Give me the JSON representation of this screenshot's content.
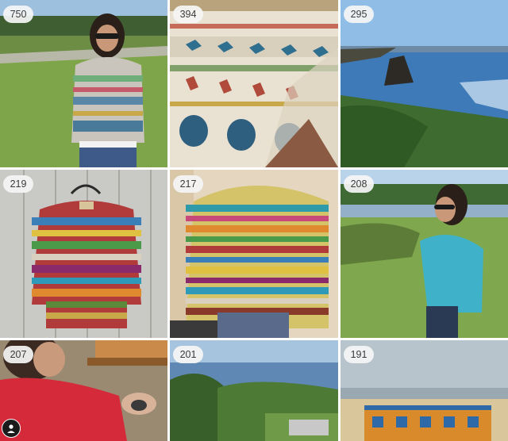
{
  "grid": {
    "tiles": [
      {
        "count": "750",
        "subject": "woman in colorwork sweater on coastal lawn"
      },
      {
        "count": "394",
        "subject": "close-up of bird and peacock colorwork knitting"
      },
      {
        "count": "295",
        "subject": "rocky coastline and ocean"
      },
      {
        "count": "219",
        "subject": "rainbow striped sweater on hanger"
      },
      {
        "count": "217",
        "subject": "striped sweater in progress on table"
      },
      {
        "count": "208",
        "subject": "woman in turquoise sweater"
      },
      {
        "count": "207",
        "subject": "woman in red cardigan knitting"
      },
      {
        "count": "201",
        "subject": "coastal view with trees"
      },
      {
        "count": "191",
        "subject": "colorwork swatch by window"
      }
    ]
  },
  "icons": {
    "profile": "person-icon"
  }
}
